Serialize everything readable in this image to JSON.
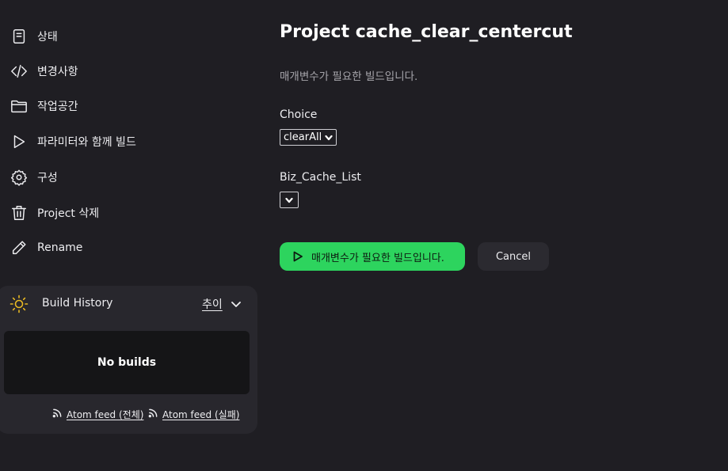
{
  "sidebar": {
    "items": [
      {
        "label": "상태",
        "icon": "document-icon"
      },
      {
        "label": "변경사항",
        "icon": "code-icon"
      },
      {
        "label": "작업공간",
        "icon": "folder-icon"
      },
      {
        "label": "파라미터와 함께 빌드",
        "icon": "play-icon"
      },
      {
        "label": "구성",
        "icon": "gear-icon"
      },
      {
        "label": "Project 삭제",
        "icon": "trash-icon"
      },
      {
        "label": "Rename",
        "icon": "pencil-icon"
      }
    ]
  },
  "build_history": {
    "title": "Build History",
    "trend_label": "추이",
    "empty_text": "No builds",
    "feeds": [
      "Atom feed (전체)",
      "Atom feed (실패)"
    ]
  },
  "main": {
    "title": "Project cache_clear_centercut",
    "description": "매개변수가 필요한 빌드입니다.",
    "params": [
      {
        "label": "Choice",
        "value": "clearAll"
      },
      {
        "label": "Biz_Cache_List",
        "value": ""
      }
    ],
    "build_button": "매개변수가 필요한 빌드입니다.",
    "cancel_button": "Cancel"
  },
  "colors": {
    "background": "#1f1e23",
    "card": "#28272d",
    "accent_green": "#2dd45e",
    "sun_yellow": "#e8b923"
  }
}
